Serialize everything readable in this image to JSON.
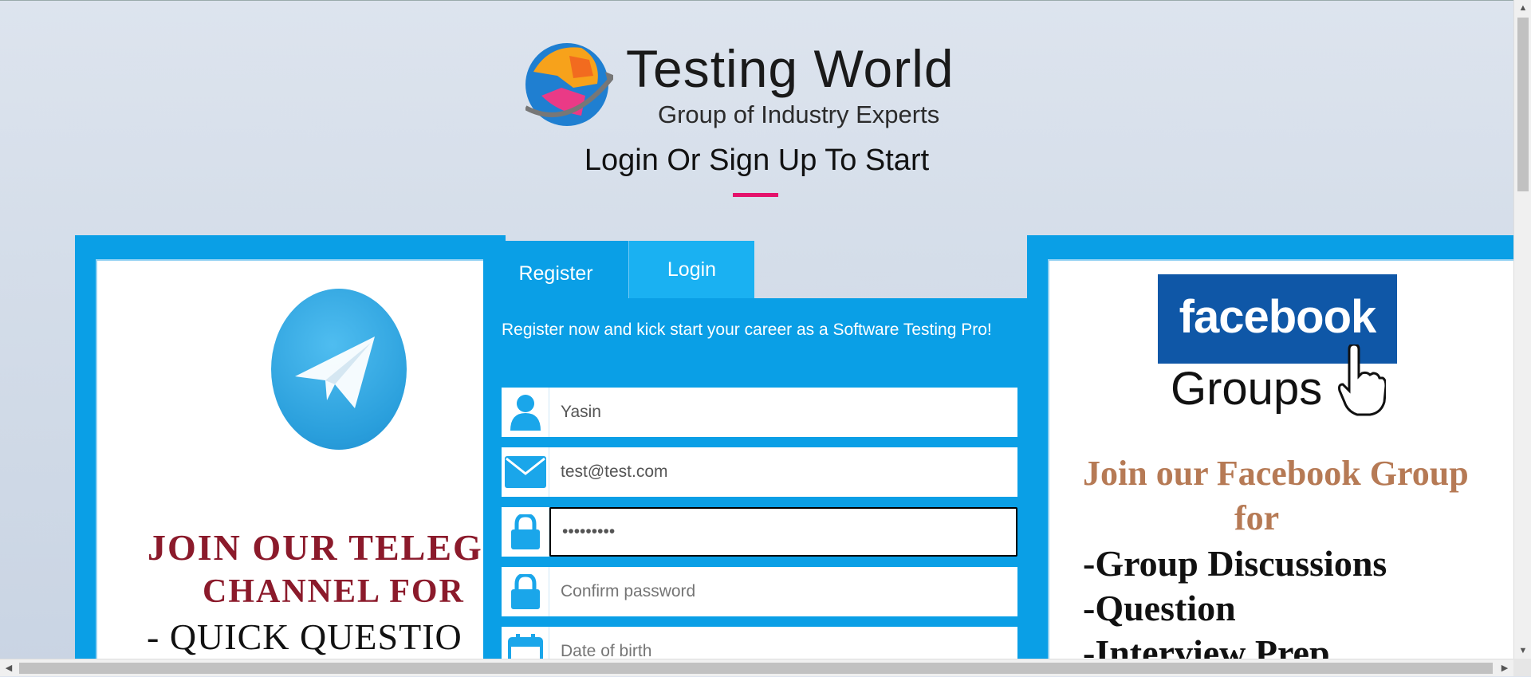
{
  "logo": {
    "title": "Testing World",
    "subtitle": "Group of Industry Experts"
  },
  "heading": "Login Or Sign Up To Start",
  "accent_color": "#e4136b",
  "brand_color": "#0a9fe6",
  "tabs": {
    "register": "Register",
    "login": "Login"
  },
  "form": {
    "intro": "Register now and kick start your career as a Software Testing Pro!",
    "username": {
      "value": "Yasin",
      "icon": "user-icon"
    },
    "email": {
      "value": "test@test.com",
      "icon": "envelope-icon"
    },
    "password": {
      "value": "•••••••••",
      "icon": "lock-icon"
    },
    "confirm_password": {
      "placeholder": "Confirm password",
      "icon": "lock-icon"
    },
    "dob": {
      "placeholder": "Date of birth",
      "icon": "calendar-icon"
    }
  },
  "telegram_card": {
    "line1": "JOIN OUR TELEG",
    "line2": "CHANNEL  FOR",
    "line3": "- QUICK QUESTIO"
  },
  "facebook_card": {
    "logo_text": "facebook",
    "groups_text": "Groups",
    "heading1": "Join our Facebook Group",
    "heading2": "for",
    "bullet1": "-Group Discussions",
    "bullet2": "-Question",
    "bullet3": "-Interview Prep"
  }
}
